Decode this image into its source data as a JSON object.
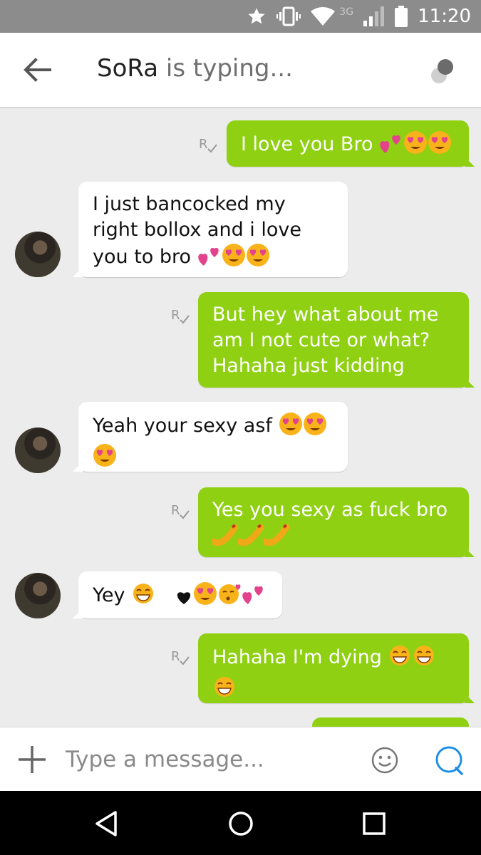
{
  "status_bar": {
    "time": "11:20",
    "network": "3G"
  },
  "header": {
    "contact_name": "SoRa",
    "typing_status": "is typing..."
  },
  "messages": [
    {
      "direction": "out",
      "text": "I love you Bro",
      "emojis": [
        "two-hearts",
        "heart-eyes",
        "heart-eyes"
      ]
    },
    {
      "direction": "in",
      "text": "I just bancocked my right bollox and i love you to bro",
      "emojis": [
        "two-hearts",
        "heart-eyes",
        "heart-eyes"
      ]
    },
    {
      "direction": "out",
      "text": "But hey what about me am I not cute or what? Hahaha just kidding",
      "emojis": []
    },
    {
      "direction": "in",
      "text": "Yeah your sexy asf",
      "emojis": [
        "heart-eyes",
        "heart-eyes",
        "heart-eyes"
      ]
    },
    {
      "direction": "out",
      "text": "Yes you sexy as fuck bro",
      "emojis": [
        "hot-dog",
        "hot-dog",
        "hot-dog"
      ]
    },
    {
      "direction": "in",
      "text": "Yey",
      "emojis": [
        "tears-of-joy",
        "black-heart",
        "heart-eyes",
        "kissing-heart",
        "two-hearts"
      ]
    },
    {
      "direction": "out",
      "text": "Hahaha I'm dying",
      "emojis": [
        "tears-of-joy",
        "tears-of-joy",
        "tears-of-joy"
      ]
    }
  ],
  "composer": {
    "placeholder": "Type a message..."
  },
  "colors": {
    "outgoing_bubble": "#8fd012",
    "incoming_bubble": "#ffffff",
    "chat_background": "#ececec",
    "status_bar": "#8c8c8c"
  }
}
